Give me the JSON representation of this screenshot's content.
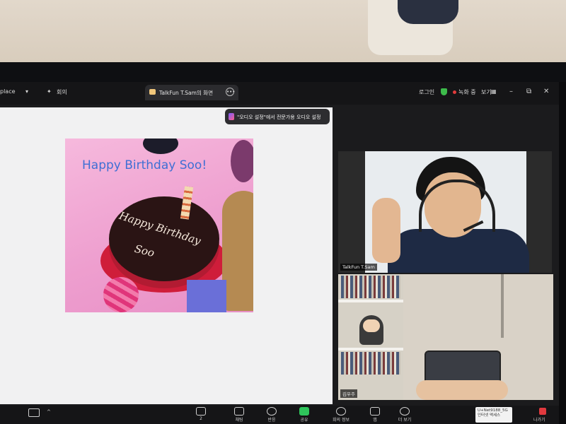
{
  "titlebar": {
    "workspace": "place",
    "meeting": "회의",
    "tab_title": "TalkFun T.Sam의 화면",
    "login": "로그인",
    "recording": "녹화 중",
    "view": "보기",
    "minimize": "–",
    "restore": "⧉",
    "close": "✕"
  },
  "notice": {
    "text": "\"오디오 설정\"에서 전문가용 오디오 설정"
  },
  "shared_image": {
    "heading": "Happy Birthday Soo!",
    "cake_line1": "Happy Birthday",
    "cake_line2": "Soo"
  },
  "participants": [
    {
      "name": "TalkFun T.Sam"
    },
    {
      "name": "김우주"
    }
  ],
  "toolbar": {
    "participants_count": "2",
    "chat": "채팅",
    "react": "반응",
    "share": "공유",
    "info": "회의 정보",
    "apps": "앱",
    "more": "더 보기",
    "leave": "나가기",
    "wifi_line1": "U+Net9188_5G",
    "wifi_line2": "인터넷 액세스"
  },
  "colors": {
    "accent_share": "#2fc55b",
    "rec_red": "#e23b3b",
    "heading_blue": "#3f6fd4"
  }
}
